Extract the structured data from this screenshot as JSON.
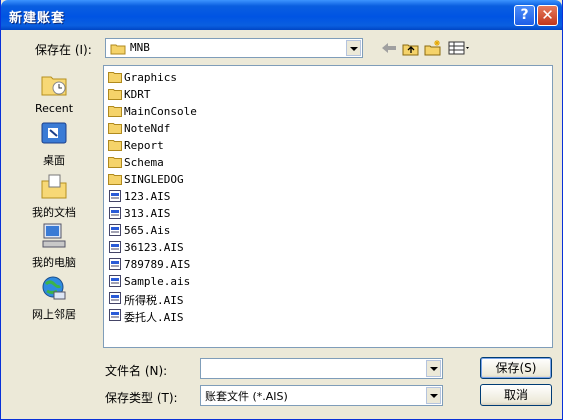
{
  "window": {
    "title": "新建账套",
    "help": "?",
    "close": "✕"
  },
  "lookin": {
    "label": "保存在 (I):",
    "value": "MNB"
  },
  "places": [
    {
      "label": "Recent",
      "icon": "recent-folder-icon"
    },
    {
      "label": "桌面",
      "icon": "desktop-icon"
    },
    {
      "label": "我的文档",
      "icon": "my-documents-icon"
    },
    {
      "label": "我的电脑",
      "icon": "my-computer-icon"
    },
    {
      "label": "网上邻居",
      "icon": "network-places-icon"
    }
  ],
  "files": [
    {
      "name": "Graphics",
      "type": "folder"
    },
    {
      "name": "KDRT",
      "type": "folder"
    },
    {
      "name": "MainConsole",
      "type": "folder"
    },
    {
      "name": "NoteNdf",
      "type": "folder"
    },
    {
      "name": "Report",
      "type": "folder"
    },
    {
      "name": "Schema",
      "type": "folder"
    },
    {
      "name": "SINGLEDOG",
      "type": "folder"
    },
    {
      "name": "123.AIS",
      "type": "file"
    },
    {
      "name": "313.AIS",
      "type": "file"
    },
    {
      "name": "565.Ais",
      "type": "file"
    },
    {
      "name": "36123.AIS",
      "type": "file"
    },
    {
      "name": "789789.AIS",
      "type": "file"
    },
    {
      "name": "Sample.ais",
      "type": "file"
    },
    {
      "name": "所得税.AIS",
      "type": "file"
    },
    {
      "name": "委托人.AIS",
      "type": "file"
    }
  ],
  "filename": {
    "label": "文件名 (N):",
    "value": ""
  },
  "filetype": {
    "label": "保存类型 (T):",
    "value": "账套文件 (*.AIS)"
  },
  "buttons": {
    "save": "保存(S)",
    "cancel": "取消"
  }
}
